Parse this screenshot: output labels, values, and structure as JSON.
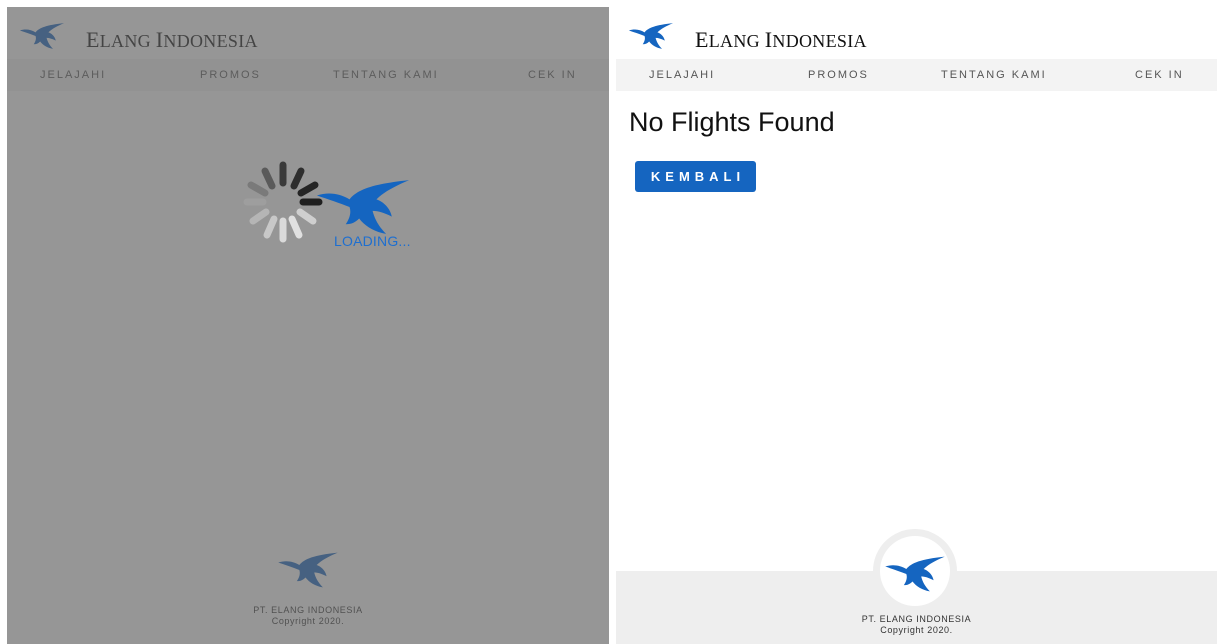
{
  "brand": {
    "first_initial": "E",
    "first_rest": "LANG",
    "second_initial": "I",
    "second_rest": "NDONESIA"
  },
  "nav": {
    "items": [
      "JELAJAHI",
      "PROMOS",
      "TENTANG KAMI",
      "CEK IN"
    ]
  },
  "loading": {
    "text": "LOADING..."
  },
  "result": {
    "title": "No Flights Found",
    "back_button": "KEMBALI"
  },
  "footer": {
    "company": "PT. ELANG INDONESIA",
    "copyright": "Copyright 2020."
  },
  "colors": {
    "brand_blue": "#1565c0",
    "overlay": "#606060",
    "nav_bg": "#f3f3f3",
    "footer_bg": "#eeeeee"
  },
  "icons": {
    "logo": "eagle-logo-icon",
    "spinner": "spinner-icon"
  }
}
